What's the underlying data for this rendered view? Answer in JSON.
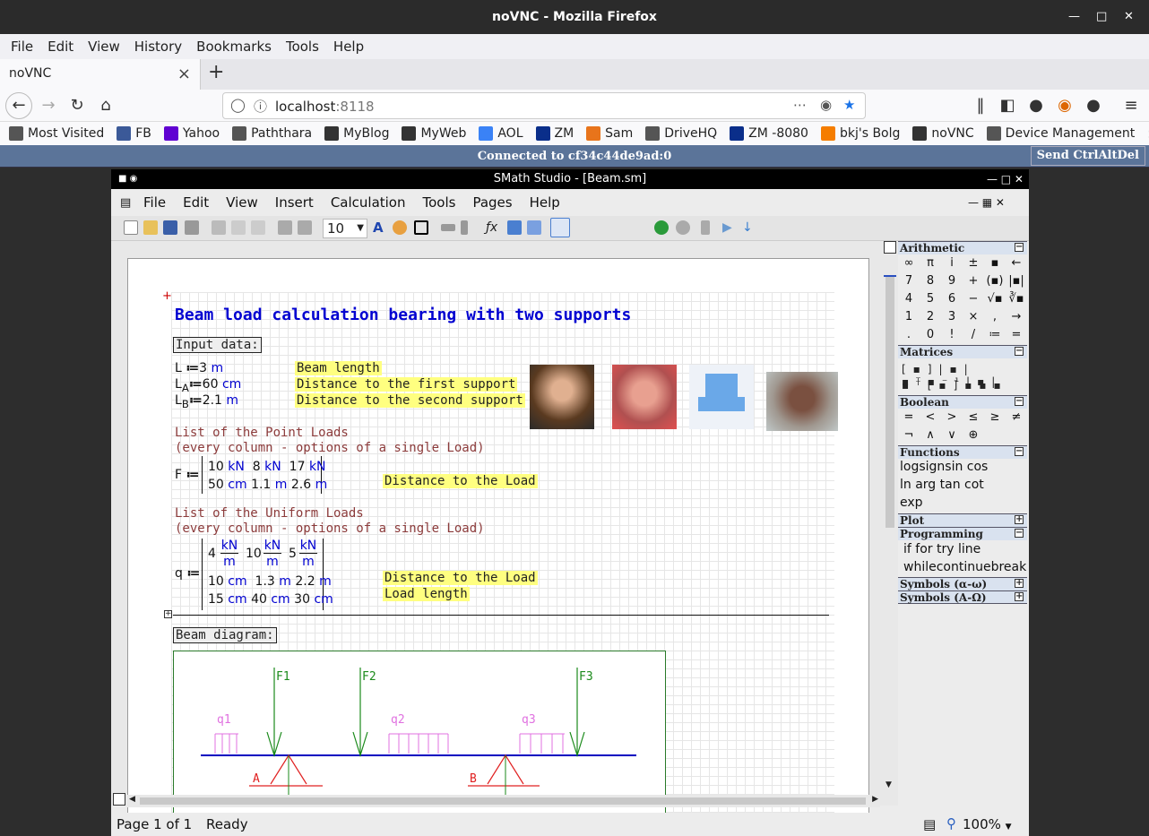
{
  "window": {
    "title": "noVNC - Mozilla Firefox"
  },
  "menu": [
    "File",
    "Edit",
    "View",
    "History",
    "Bookmarks",
    "Tools",
    "Help"
  ],
  "tab": {
    "label": "noVNC"
  },
  "url": {
    "host": "localhost",
    "port": ":8118"
  },
  "bookmarks": [
    {
      "label": "Most Visited",
      "icon": "gear-icon",
      "color": "#555"
    },
    {
      "label": "FB",
      "icon": "facebook-icon",
      "color": "#3b5998"
    },
    {
      "label": "Yahoo",
      "icon": "yahoo-icon",
      "color": "#6001d2"
    },
    {
      "label": "Paththara",
      "icon": "person-icon",
      "color": "#555"
    },
    {
      "label": "MyBlog",
      "icon": "blog-icon",
      "color": "#333"
    },
    {
      "label": "MyWeb",
      "icon": "w-icon",
      "color": "#333"
    },
    {
      "label": "AOL",
      "icon": "aol-icon",
      "color": "#3a82f6"
    },
    {
      "label": "ZM",
      "icon": "zm-icon",
      "color": "#0a2e8a"
    },
    {
      "label": "Sam",
      "icon": "fire-icon",
      "color": "#e8741b"
    },
    {
      "label": "DriveHQ",
      "icon": "globe-icon",
      "color": "#555"
    },
    {
      "label": "ZM -8080",
      "icon": "zm-icon",
      "color": "#0a2e8a"
    },
    {
      "label": "bkj's Bolg",
      "icon": "blogger-icon",
      "color": "#f57d00"
    },
    {
      "label": "noVNC",
      "icon": "novnc-icon",
      "color": "#333"
    },
    {
      "label": "Device Management",
      "icon": "globe-icon",
      "color": "#555"
    }
  ],
  "vnc": {
    "status": "Connected to cf34c44de9ad:0",
    "send": "Send CtrlAltDel"
  },
  "smath": {
    "title": "SMath Studio - [Beam.sm]",
    "menu": [
      "File",
      "Edit",
      "View",
      "Insert",
      "Calculation",
      "Tools",
      "Pages",
      "Help"
    ],
    "fontsize": "10",
    "status": {
      "page": "Page 1 of 1",
      "state": "Ready",
      "zoom": "100%"
    }
  },
  "doc": {
    "heading": "Beam load calculation bearing with two supports",
    "input_label": "Input data:",
    "vars": [
      {
        "name": "L",
        "sub": "",
        "val": "3",
        "unit": "m",
        "note": "Beam length"
      },
      {
        "name": "L",
        "sub": "A",
        "val": "60",
        "unit": "cm",
        "note": "Distance to the first support"
      },
      {
        "name": "L",
        "sub": "B",
        "val": "2.1",
        "unit": "m",
        "note": "Distance to the second support"
      }
    ],
    "point_title": "List of the Point Loads",
    "point_sub": "(every column - options of  a single Load)",
    "F": {
      "name": "F",
      "row1": [
        "10",
        "kN",
        "8",
        "kN",
        "17",
        "kN"
      ],
      "row2": [
        "50",
        "cm",
        "1.1",
        "m",
        "2.6",
        "m"
      ],
      "note": "Distance to the Load"
    },
    "uniform_title": "List of the Uniform Loads",
    "uniform_sub": "(every column - options of  a single Load)",
    "q": {
      "name": "q",
      "frac": [
        "4",
        "10",
        "5"
      ],
      "frac_num": "kN",
      "frac_den": "m",
      "row2": [
        "10",
        "cm",
        "1.3",
        "m",
        "2.2",
        "m"
      ],
      "row3": [
        "15",
        "cm",
        "40",
        "cm",
        "30",
        "cm"
      ],
      "note1": "Distance to the Load",
      "note2": "Load length"
    },
    "diagram_label": "Beam diagram:",
    "diagram": {
      "F1": "F1",
      "F2": "F2",
      "F3": "F3",
      "q1": "q1",
      "q2": "q2",
      "q3": "q3",
      "A": "A",
      "B": "B"
    }
  },
  "panel": {
    "arithmetic": "Arithmetic",
    "arith_keys": [
      "∞",
      "π",
      "i",
      "±",
      "▪",
      "←",
      "7",
      "8",
      "9",
      "+",
      "(▪)",
      "|▪|",
      "4",
      "5",
      "6",
      "−",
      "√▪",
      "∛▪",
      "1",
      "2",
      "3",
      "×",
      ",",
      "→",
      ".",
      "0",
      "!",
      "/",
      "≔",
      "="
    ],
    "matrices": "Matrices",
    "boolean": "Boolean",
    "bool_keys": [
      "=",
      "<",
      ">",
      "≤",
      "≥",
      "≠",
      "¬",
      "∧",
      "∨",
      "⊕"
    ],
    "functions": "Functions",
    "func_row1": "logsignsin cos",
    "func_row2": "ln  arg tan cot",
    "func_row3": "exp",
    "plot": "Plot",
    "programming": "Programming",
    "prog_row1": "if  for    try      line",
    "prog_row2": "whilecontinuebreak",
    "sym1": "Symbols (α-ω)",
    "sym2": "Symbols (A-Ω)"
  }
}
